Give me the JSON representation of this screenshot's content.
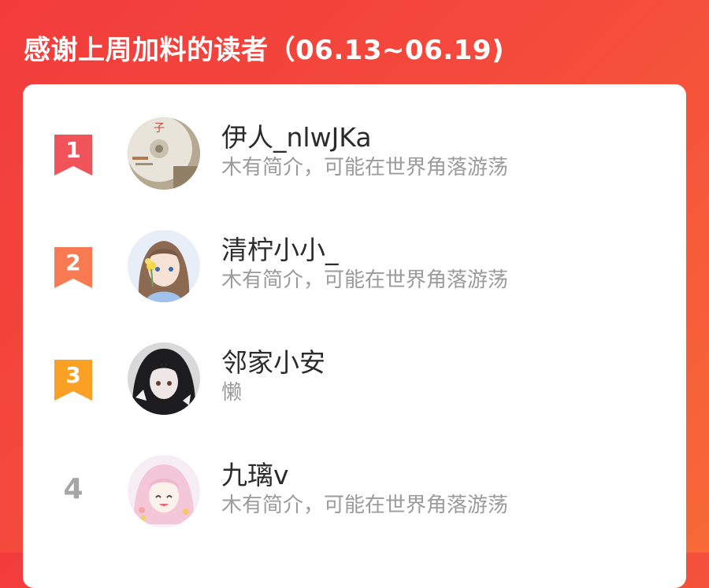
{
  "header": {
    "title": "感谢上周加料的读者（06.13~06.19)"
  },
  "readers": [
    {
      "rank": "1",
      "name": "伊人_nlwJKa",
      "bio": "木有简介，可能在世界角落游荡",
      "badge_color": "#f0535a",
      "avatar_icon": "disc-avatar-icon"
    },
    {
      "rank": "2",
      "name": "清柠小小_",
      "bio": "木有简介，可能在世界角落游荡",
      "badge_color": "#f77a52",
      "avatar_icon": "anime-girl-flower-avatar-icon"
    },
    {
      "rank": "3",
      "name": "邻家小安",
      "bio": "懒",
      "badge_color": "#f9a025",
      "avatar_icon": "dark-haired-girl-avatar-icon"
    },
    {
      "rank": "4",
      "name": "九璃v",
      "bio": "木有简介，可能在世界角落游荡",
      "avatar_icon": "pink-anime-girl-avatar-icon"
    }
  ]
}
